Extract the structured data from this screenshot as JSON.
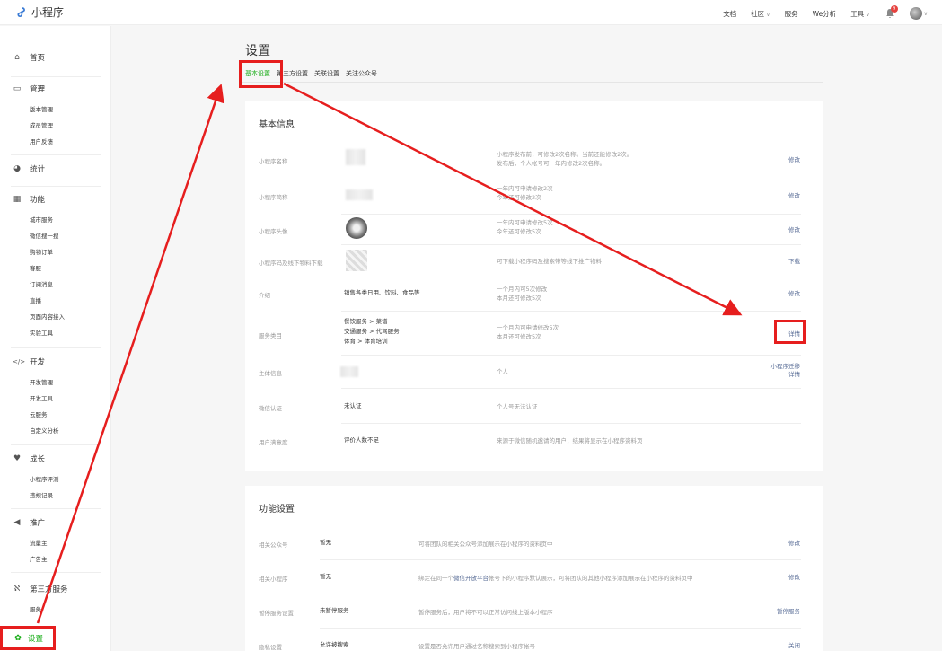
{
  "app": {
    "title": "小程序"
  },
  "topnav": {
    "docs": "文档",
    "community": "社区",
    "service": "服务",
    "analytics": "We分析",
    "tools": "工具",
    "notification_count": "9"
  },
  "sidebar": {
    "home": "首页",
    "manage": {
      "label": "管理",
      "items": [
        "版本管理",
        "成员管理",
        "用户反馈"
      ]
    },
    "stats": "统计",
    "features": {
      "label": "功能",
      "items": [
        "城市服务",
        "微信搜一搜",
        "购物订单",
        "客服",
        "订阅消息",
        "直播",
        "页面内容接入",
        "实验工具"
      ]
    },
    "dev": {
      "label": "开发",
      "items": [
        "开发管理",
        "开发工具",
        "云服务",
        "自定义分析"
      ]
    },
    "growth": {
      "label": "成长",
      "items": [
        "小程序评测",
        "违规记录"
      ]
    },
    "promo": {
      "label": "推广",
      "items": [
        "流量主",
        "广告主"
      ]
    },
    "thirdparty": {
      "label": "第三方服务",
      "items": [
        "服务"
      ]
    },
    "settings": "设置"
  },
  "page": {
    "title": "设置",
    "tabs": [
      "基本设置",
      "第三方设置",
      "关联设置",
      "关注公众号"
    ]
  },
  "basic_info": {
    "title": "基本信息",
    "rows": [
      {
        "label": "小程序名称",
        "value": "",
        "desc1": "小程序发布前，可修改2次名称。当前还能修改2次。",
        "desc2": "发布后，个人帐号可一年内修改2次名称。",
        "action": "修改"
      },
      {
        "label": "小程序简称",
        "value": "",
        "desc1": "一年内可申请修改2次",
        "desc2": "今年还可修改2次",
        "action": "修改"
      },
      {
        "label": "小程序头像",
        "value": "",
        "desc1": "一年内可申请修改5次",
        "desc2": "今年还可修改5次",
        "action": "修改"
      },
      {
        "label": "小程序码及线下物料下载",
        "value": "",
        "desc1": "可下载小程序码及搜索带等线下推广物料",
        "desc2": "",
        "action": "下载"
      },
      {
        "label": "介绍",
        "value": "销售各类日用、饮料、食品等",
        "desc1": "一个月内可5次修改",
        "desc2": "本月还可修改5次",
        "action": "修改"
      },
      {
        "label": "服务类目",
        "value1": "餐饮服务 > 菜谱",
        "value2": "交通服务 > 代驾服务",
        "value3": "体育 > 体育培训",
        "desc1": "一个月内可申请修改5次",
        "desc2": "本月还可修改5次",
        "action": "详情"
      },
      {
        "label": "主体信息",
        "value": "",
        "desc1": "个人",
        "desc2": "",
        "action1": "小程序迁移",
        "action2": "详情"
      },
      {
        "label": "微信认证",
        "value": "未认证",
        "desc1": "个人号无法认证",
        "desc2": "",
        "action": ""
      },
      {
        "label": "用户满意度",
        "value": "评价人数不足",
        "desc1": "来源于微信随机邀请的用户，结果将显示在小程序资料页",
        "desc2": "",
        "action": ""
      }
    ]
  },
  "feature_settings": {
    "title": "功能设置",
    "rows": [
      {
        "label": "相关公众号",
        "value": "暂无",
        "desc": "可将团队的相关公众号添加展示在小程序的资料页中",
        "action": "修改"
      },
      {
        "label": "相关小程序",
        "value": "暂无",
        "desc_a": "绑定在同一个",
        "desc_link": "微信开放平台",
        "desc_b": "帐号下的小程序默认展示，可将团队的其他小程序添加展示在小程序的资料页中",
        "action": "修改"
      },
      {
        "label": "暂停服务设置",
        "value": "未暂停服务",
        "desc": "暂停服务后，用户将不可以正常访问线上版本小程序",
        "action": "暂停服务"
      },
      {
        "label": "隐私设置",
        "value": "允许被搜索",
        "desc": "设置是否允许用户通过名称搜索到小程序帐号",
        "action": "关闭"
      }
    ]
  },
  "colors": {
    "accent": "#1aad19",
    "link": "#576b95",
    "highlight": "#e61e1e"
  }
}
